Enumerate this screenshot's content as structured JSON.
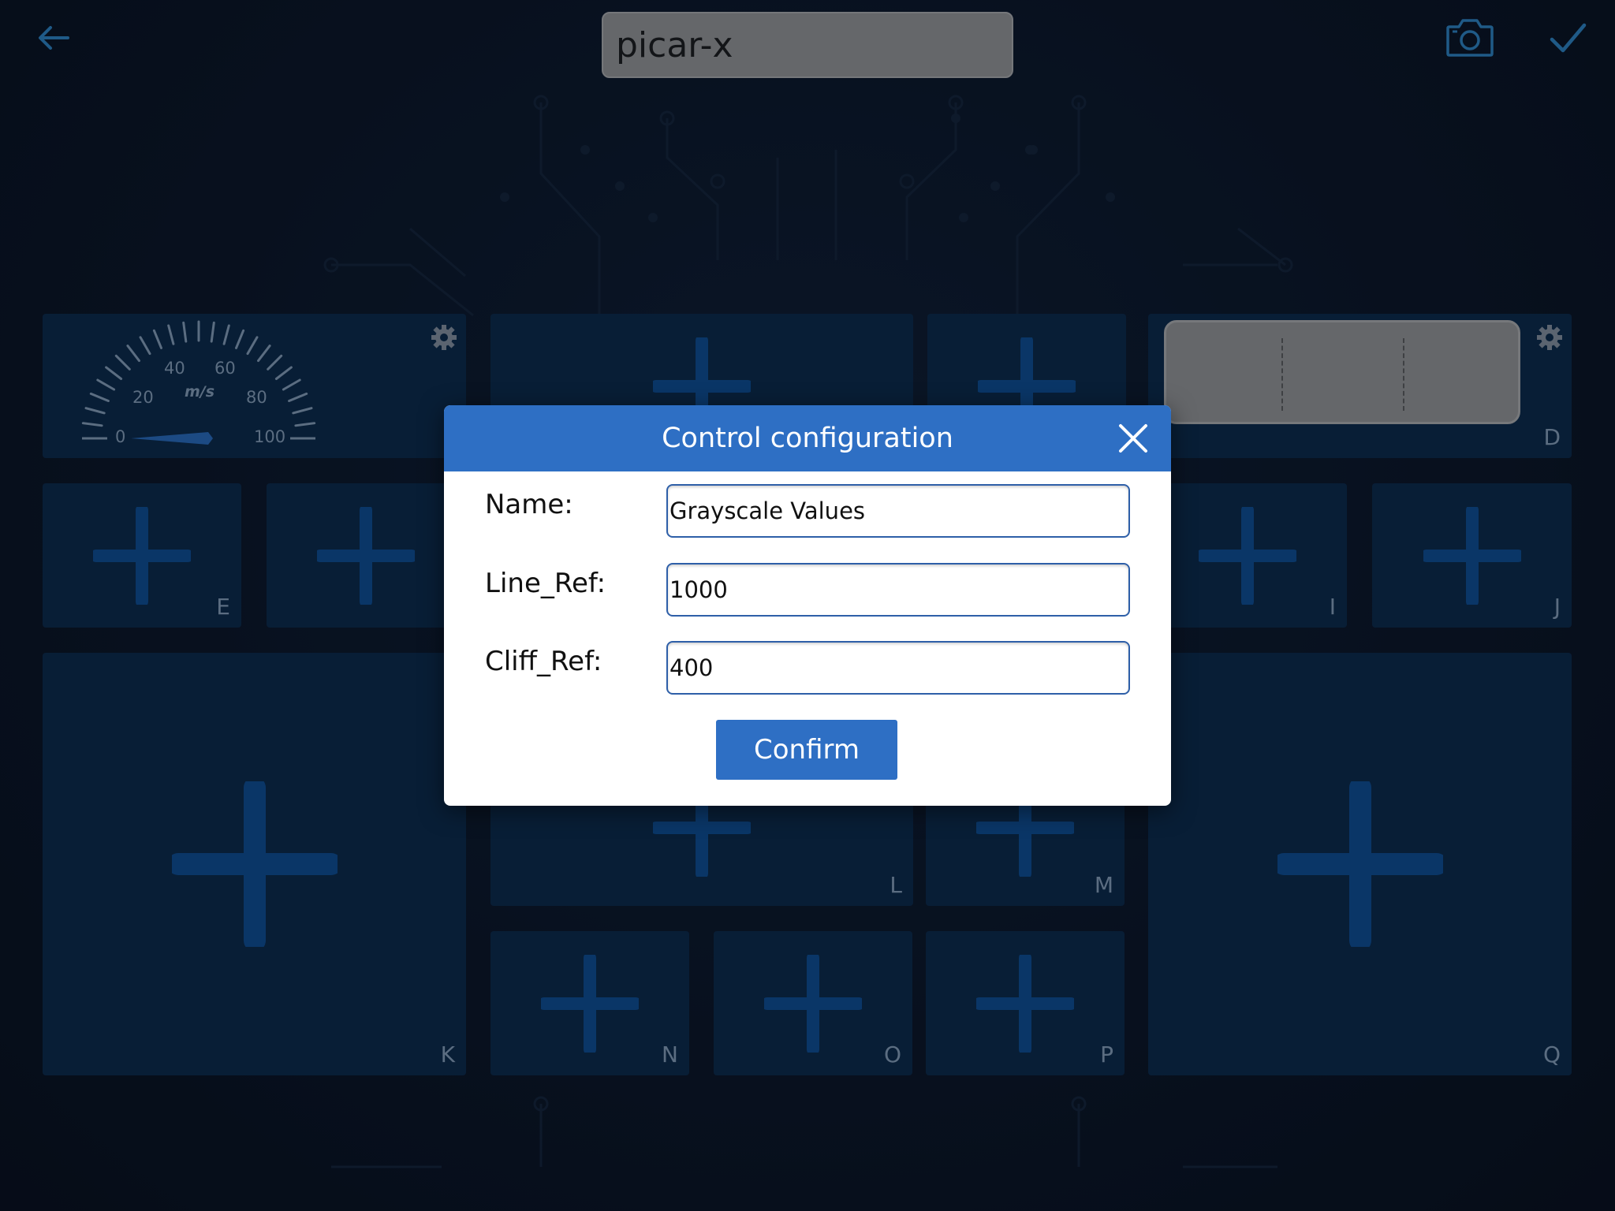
{
  "toolbar": {
    "title_value": "picar-x",
    "back_icon": "arrow-left-icon",
    "camera_icon": "camera-icon",
    "done_icon": "checkmark-icon",
    "icon_color": "#2f86c6"
  },
  "gauge": {
    "unit": "m/s",
    "ticks": [
      "0",
      "20",
      "40",
      "60",
      "80",
      "100"
    ],
    "value": 0
  },
  "tiles": {
    "D": "D",
    "E": "E",
    "I": "I",
    "J": "J",
    "K": "K",
    "L": "L",
    "M": "M",
    "N": "N",
    "O": "O",
    "P": "P",
    "Q": "Q"
  },
  "modal": {
    "title": "Control configuration",
    "fields": [
      {
        "label": "Name:",
        "value": "Grayscale Values"
      },
      {
        "label": "Line_Ref:",
        "value": "1000"
      },
      {
        "label": "Cliff_Ref:",
        "value": "400"
      }
    ],
    "confirm_label": "Confirm"
  },
  "colors": {
    "accent": "#2e6fc4",
    "tile_bg": "#0c2a4a",
    "plus_color": "#0e4f95",
    "background": "#0b1526"
  }
}
